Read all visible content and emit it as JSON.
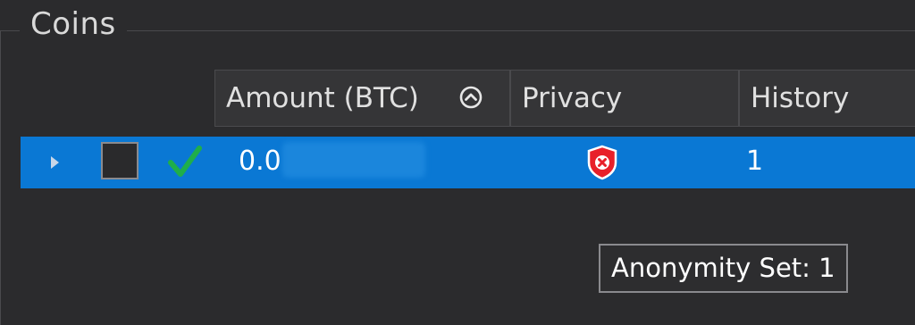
{
  "section": {
    "title": "Coins"
  },
  "table": {
    "columns": {
      "amount": "Amount (BTC)",
      "privacy": "Privacy",
      "history": "History"
    },
    "sort_icon": "chevron-up-circle-icon",
    "rows": [
      {
        "expander_icon": "caret-right-icon",
        "selected": false,
        "confirmed_icon": "checkmark-icon",
        "amount": "0.0",
        "privacy_icon": "shield-x-icon",
        "history": "1"
      }
    ]
  },
  "tooltip": {
    "text": "Anonymity Set: 1"
  },
  "colors": {
    "background": "#2b2b2d",
    "selection": "#0a78d4",
    "confirmed": "#1fae4a",
    "privacy_bad": "#e8202a"
  }
}
